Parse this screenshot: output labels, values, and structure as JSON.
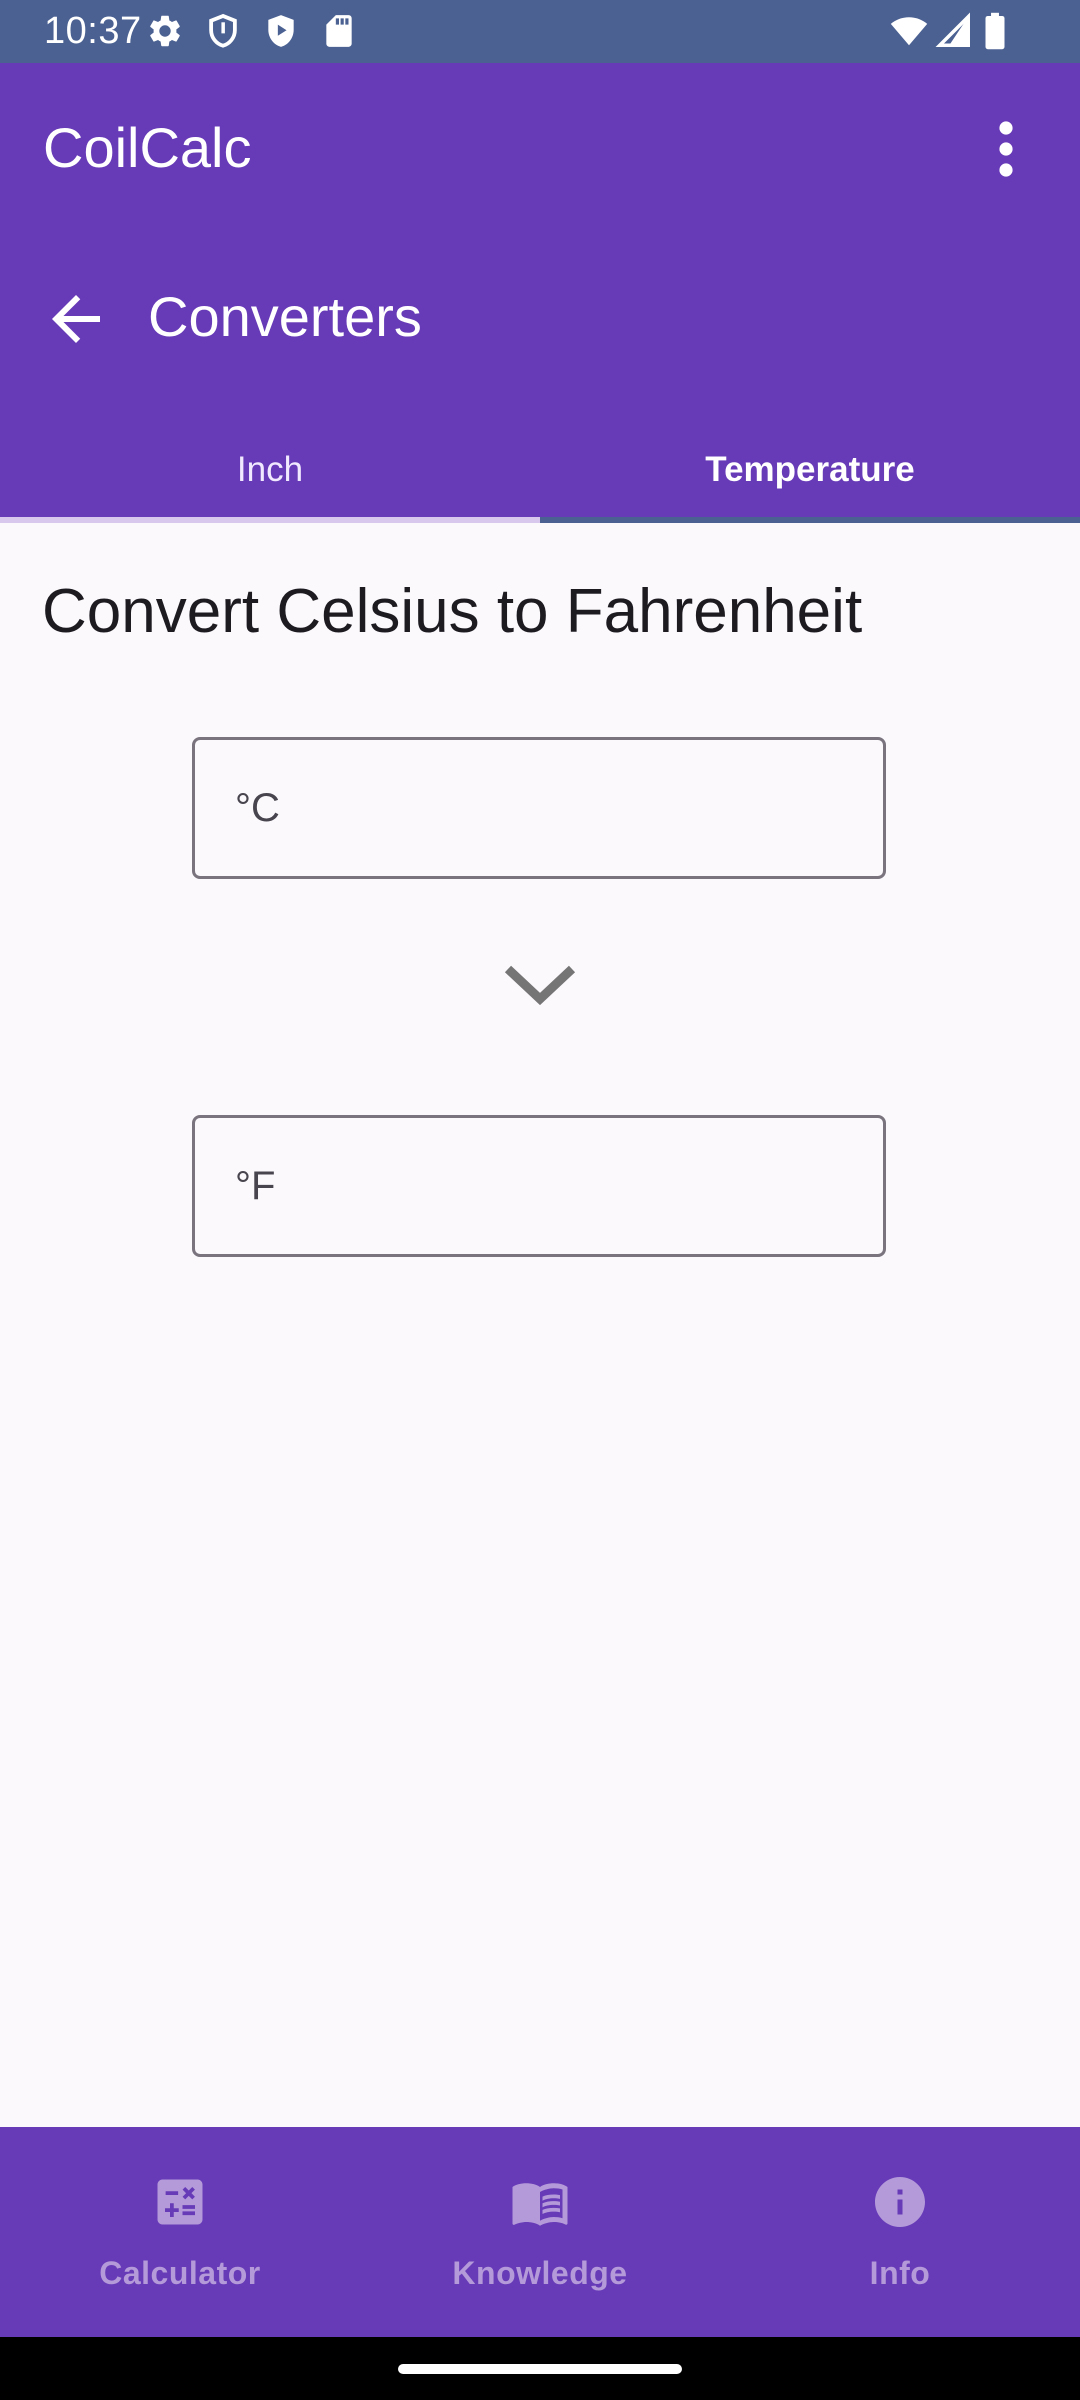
{
  "status_bar": {
    "time": "10:37",
    "left_icons": [
      "gear-icon",
      "shield-icon",
      "play-shield-icon",
      "sd-card-icon"
    ],
    "right_icons": [
      "wifi-icon",
      "signal-icon",
      "battery-icon"
    ]
  },
  "app_bar": {
    "title": "CoilCalc",
    "section_title": "Converters",
    "color": "#673ab7"
  },
  "tabs": [
    {
      "label": "Inch",
      "selected": false
    },
    {
      "label": "Temperature",
      "selected": true
    }
  ],
  "main": {
    "heading": "Convert Celsius to Fahrenheit",
    "celsius": {
      "placeholder": "°C",
      "value": ""
    },
    "fahrenheit": {
      "placeholder": "°F",
      "value": ""
    }
  },
  "bottom_nav": {
    "items": [
      {
        "label": "Calculator",
        "icon": "calculator-icon"
      },
      {
        "label": "Knowledge",
        "icon": "book-icon"
      },
      {
        "label": "Info",
        "icon": "info-icon"
      }
    ]
  },
  "colors": {
    "accent": "#673ab7",
    "status_bar": "#4b6192",
    "nav_label": "#b49ad9",
    "background": "#fcf9fd"
  }
}
